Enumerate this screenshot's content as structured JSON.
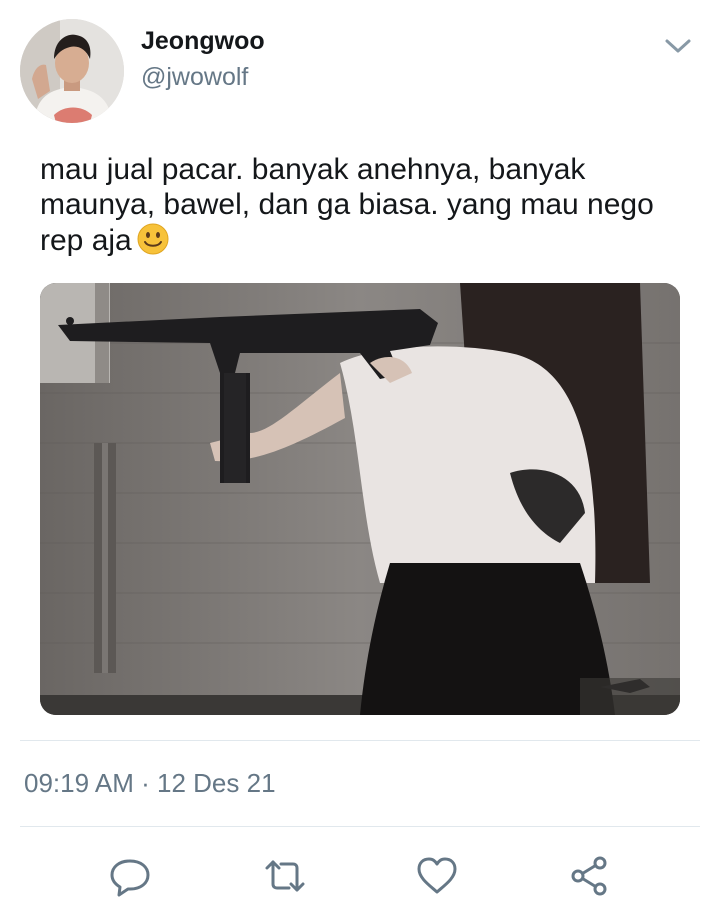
{
  "user": {
    "display_name": "Jeongwoo",
    "handle": "@jwowolf"
  },
  "tweet": {
    "text": "mau jual pacar. banyak anehnya, banyak maunya, bawel, dan ga biasa. yang mau nego rep aja",
    "emoji": "slightly-smiling-face"
  },
  "meta": {
    "time": "09:19 AM",
    "separator": "·",
    "date": "12 Des 21"
  },
  "actions": [
    "reply",
    "retweet",
    "like",
    "share"
  ],
  "colors": {
    "text_primary": "#14171a",
    "text_secondary": "#657786",
    "divider": "#e1e8ed",
    "emoji_yellow": "#f7c23a"
  }
}
